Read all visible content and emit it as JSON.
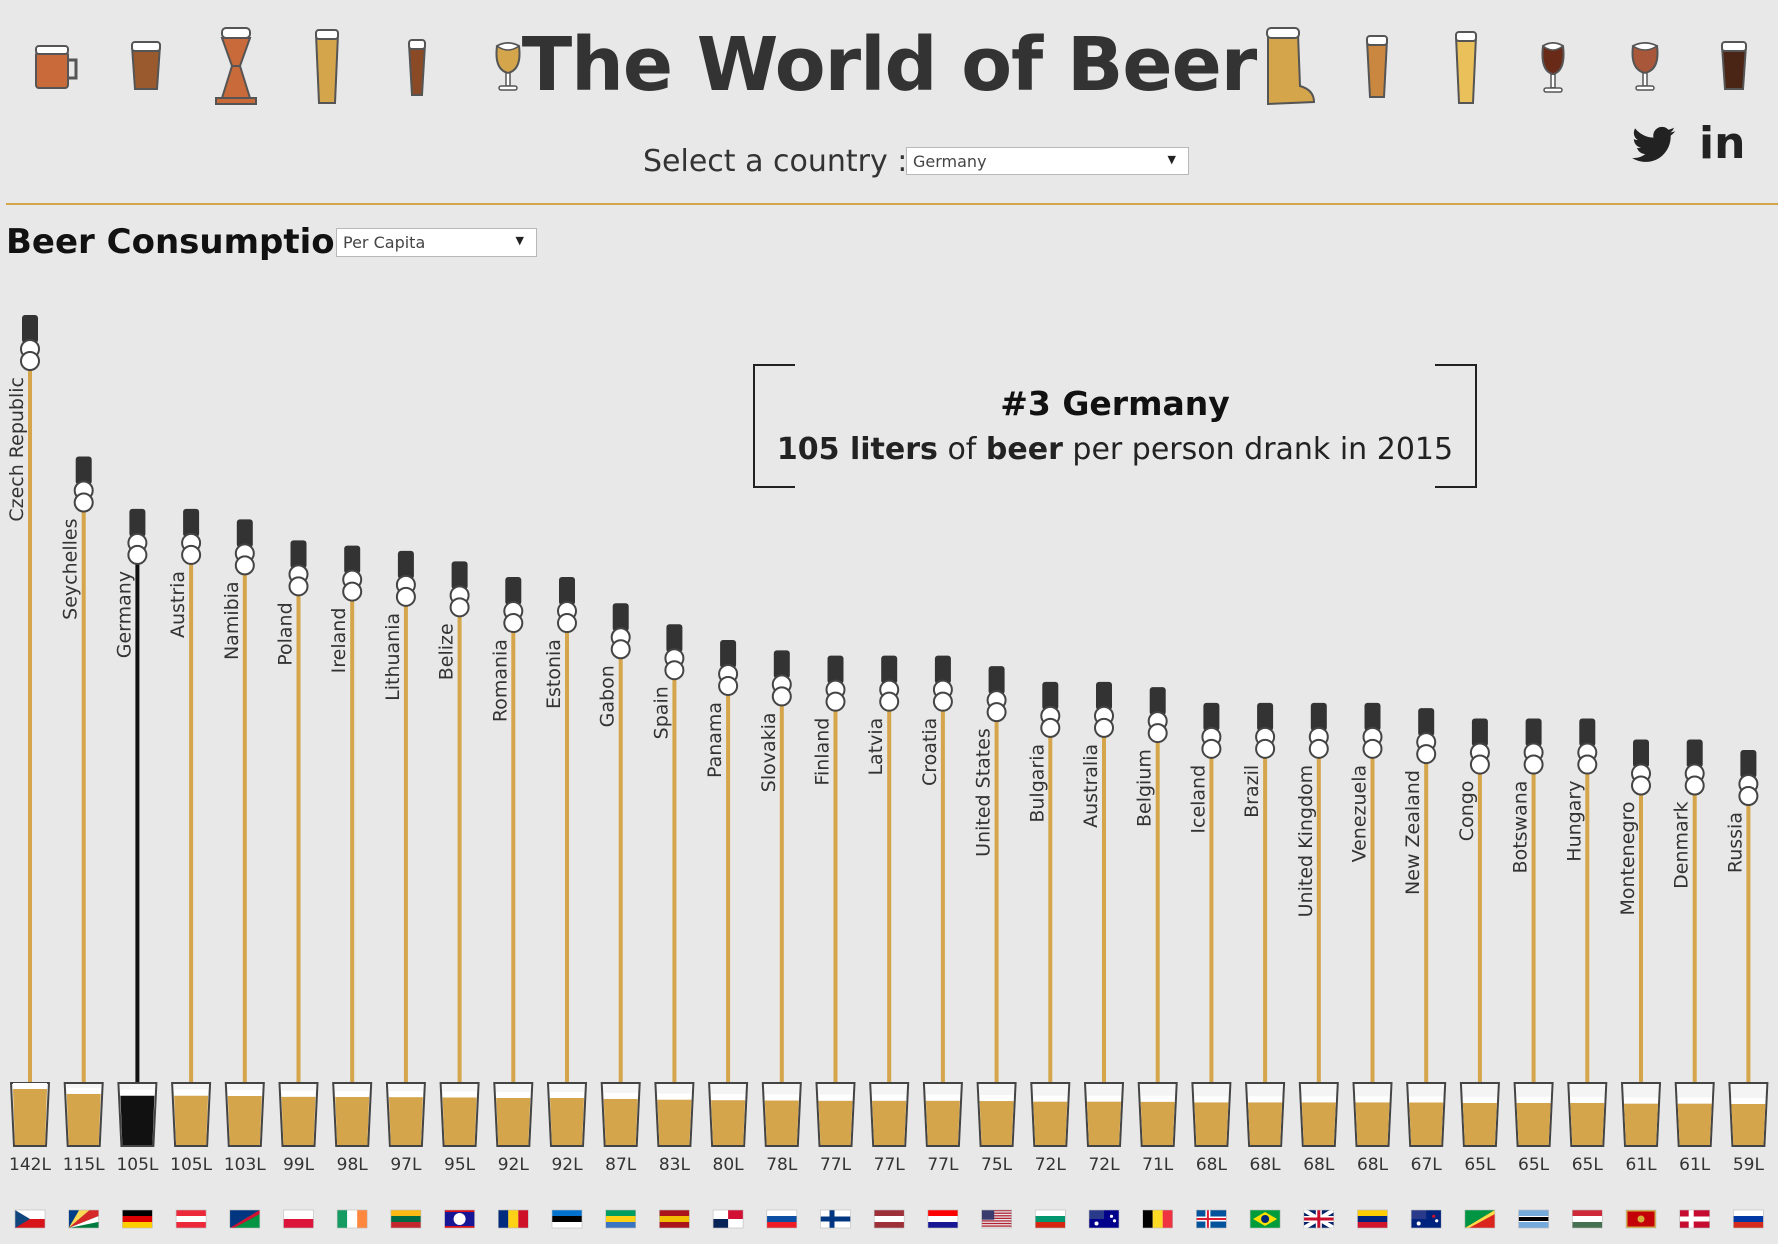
{
  "header": {
    "title": "The World of Beer",
    "select_label": "Select a country :",
    "selected_country": "Germany",
    "social": {
      "twitter_icon": "twitter-bird-icon",
      "linkedin_label": "in"
    }
  },
  "section": {
    "title": "Beer Consumption",
    "measure": "Per Capita"
  },
  "callout": {
    "rank": "#3 Germany",
    "liters": "105 liters",
    "of": "of",
    "beer": "beer",
    "rest": "per person drank in 2015"
  },
  "colors": {
    "beer": "#d4a54a",
    "highlight": "#111111",
    "background": "#e8e8e8",
    "text": "#2d2d2d"
  },
  "chart_data": {
    "type": "bar",
    "title": "",
    "ylabel": "",
    "xlabel": "",
    "highlight": "Germany",
    "unit": "L",
    "categories": [
      "Czech Republic",
      "Seychelles",
      "Germany",
      "Austria",
      "Namibia",
      "Poland",
      "Ireland",
      "Lithuania",
      "Belize",
      "Romania",
      "Estonia",
      "Gabon",
      "Spain",
      "Panama",
      "Slovakia",
      "Finland",
      "Latvia",
      "Croatia",
      "United States",
      "Bulgaria",
      "Australia",
      "Belgium",
      "Iceland",
      "Brazil",
      "United Kingdom",
      "Venezuela",
      "New Zealand",
      "Congo",
      "Botswana",
      "Hungary",
      "Montenegro",
      "Denmark",
      "Russia"
    ],
    "values": [
      142,
      115,
      105,
      105,
      103,
      99,
      98,
      97,
      95,
      92,
      92,
      87,
      83,
      80,
      78,
      77,
      77,
      77,
      75,
      72,
      72,
      71,
      68,
      68,
      68,
      68,
      67,
      65,
      65,
      65,
      61,
      61,
      59
    ],
    "value_labels": [
      "142L",
      "115L",
      "105L",
      "105L",
      "103L",
      "99L",
      "98L",
      "97L",
      "95L",
      "92L",
      "92L",
      "87L",
      "83L",
      "80L",
      "78L",
      "77L",
      "77L",
      "77L",
      "75L",
      "72L",
      "72L",
      "71L",
      "68L",
      "68L",
      "68L",
      "68L",
      "67L",
      "65L",
      "65L",
      "65L",
      "61L",
      "61L",
      "59L"
    ]
  }
}
